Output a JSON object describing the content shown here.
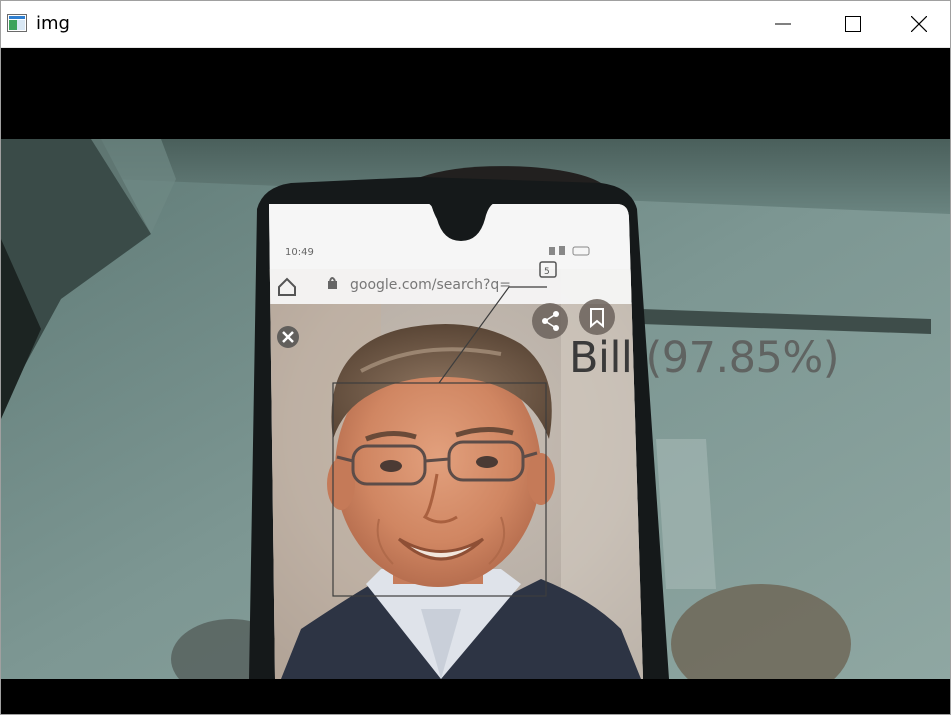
{
  "window": {
    "title": "img",
    "icons": {
      "app": "image-window-icon",
      "minimize": "minimize-icon",
      "maximize": "maximize-icon",
      "close": "close-icon"
    }
  },
  "phone_ui": {
    "status_time": "10:49",
    "address_text": "google.com/search?q=",
    "tab_count": "5",
    "icons": [
      "home-icon",
      "lock-icon",
      "tabs-icon",
      "share-icon",
      "bookmark-icon",
      "close-icon"
    ]
  },
  "detection": {
    "name": "Bill",
    "confidence": "(97.85%)",
    "box_color": "#3d3d3d"
  }
}
